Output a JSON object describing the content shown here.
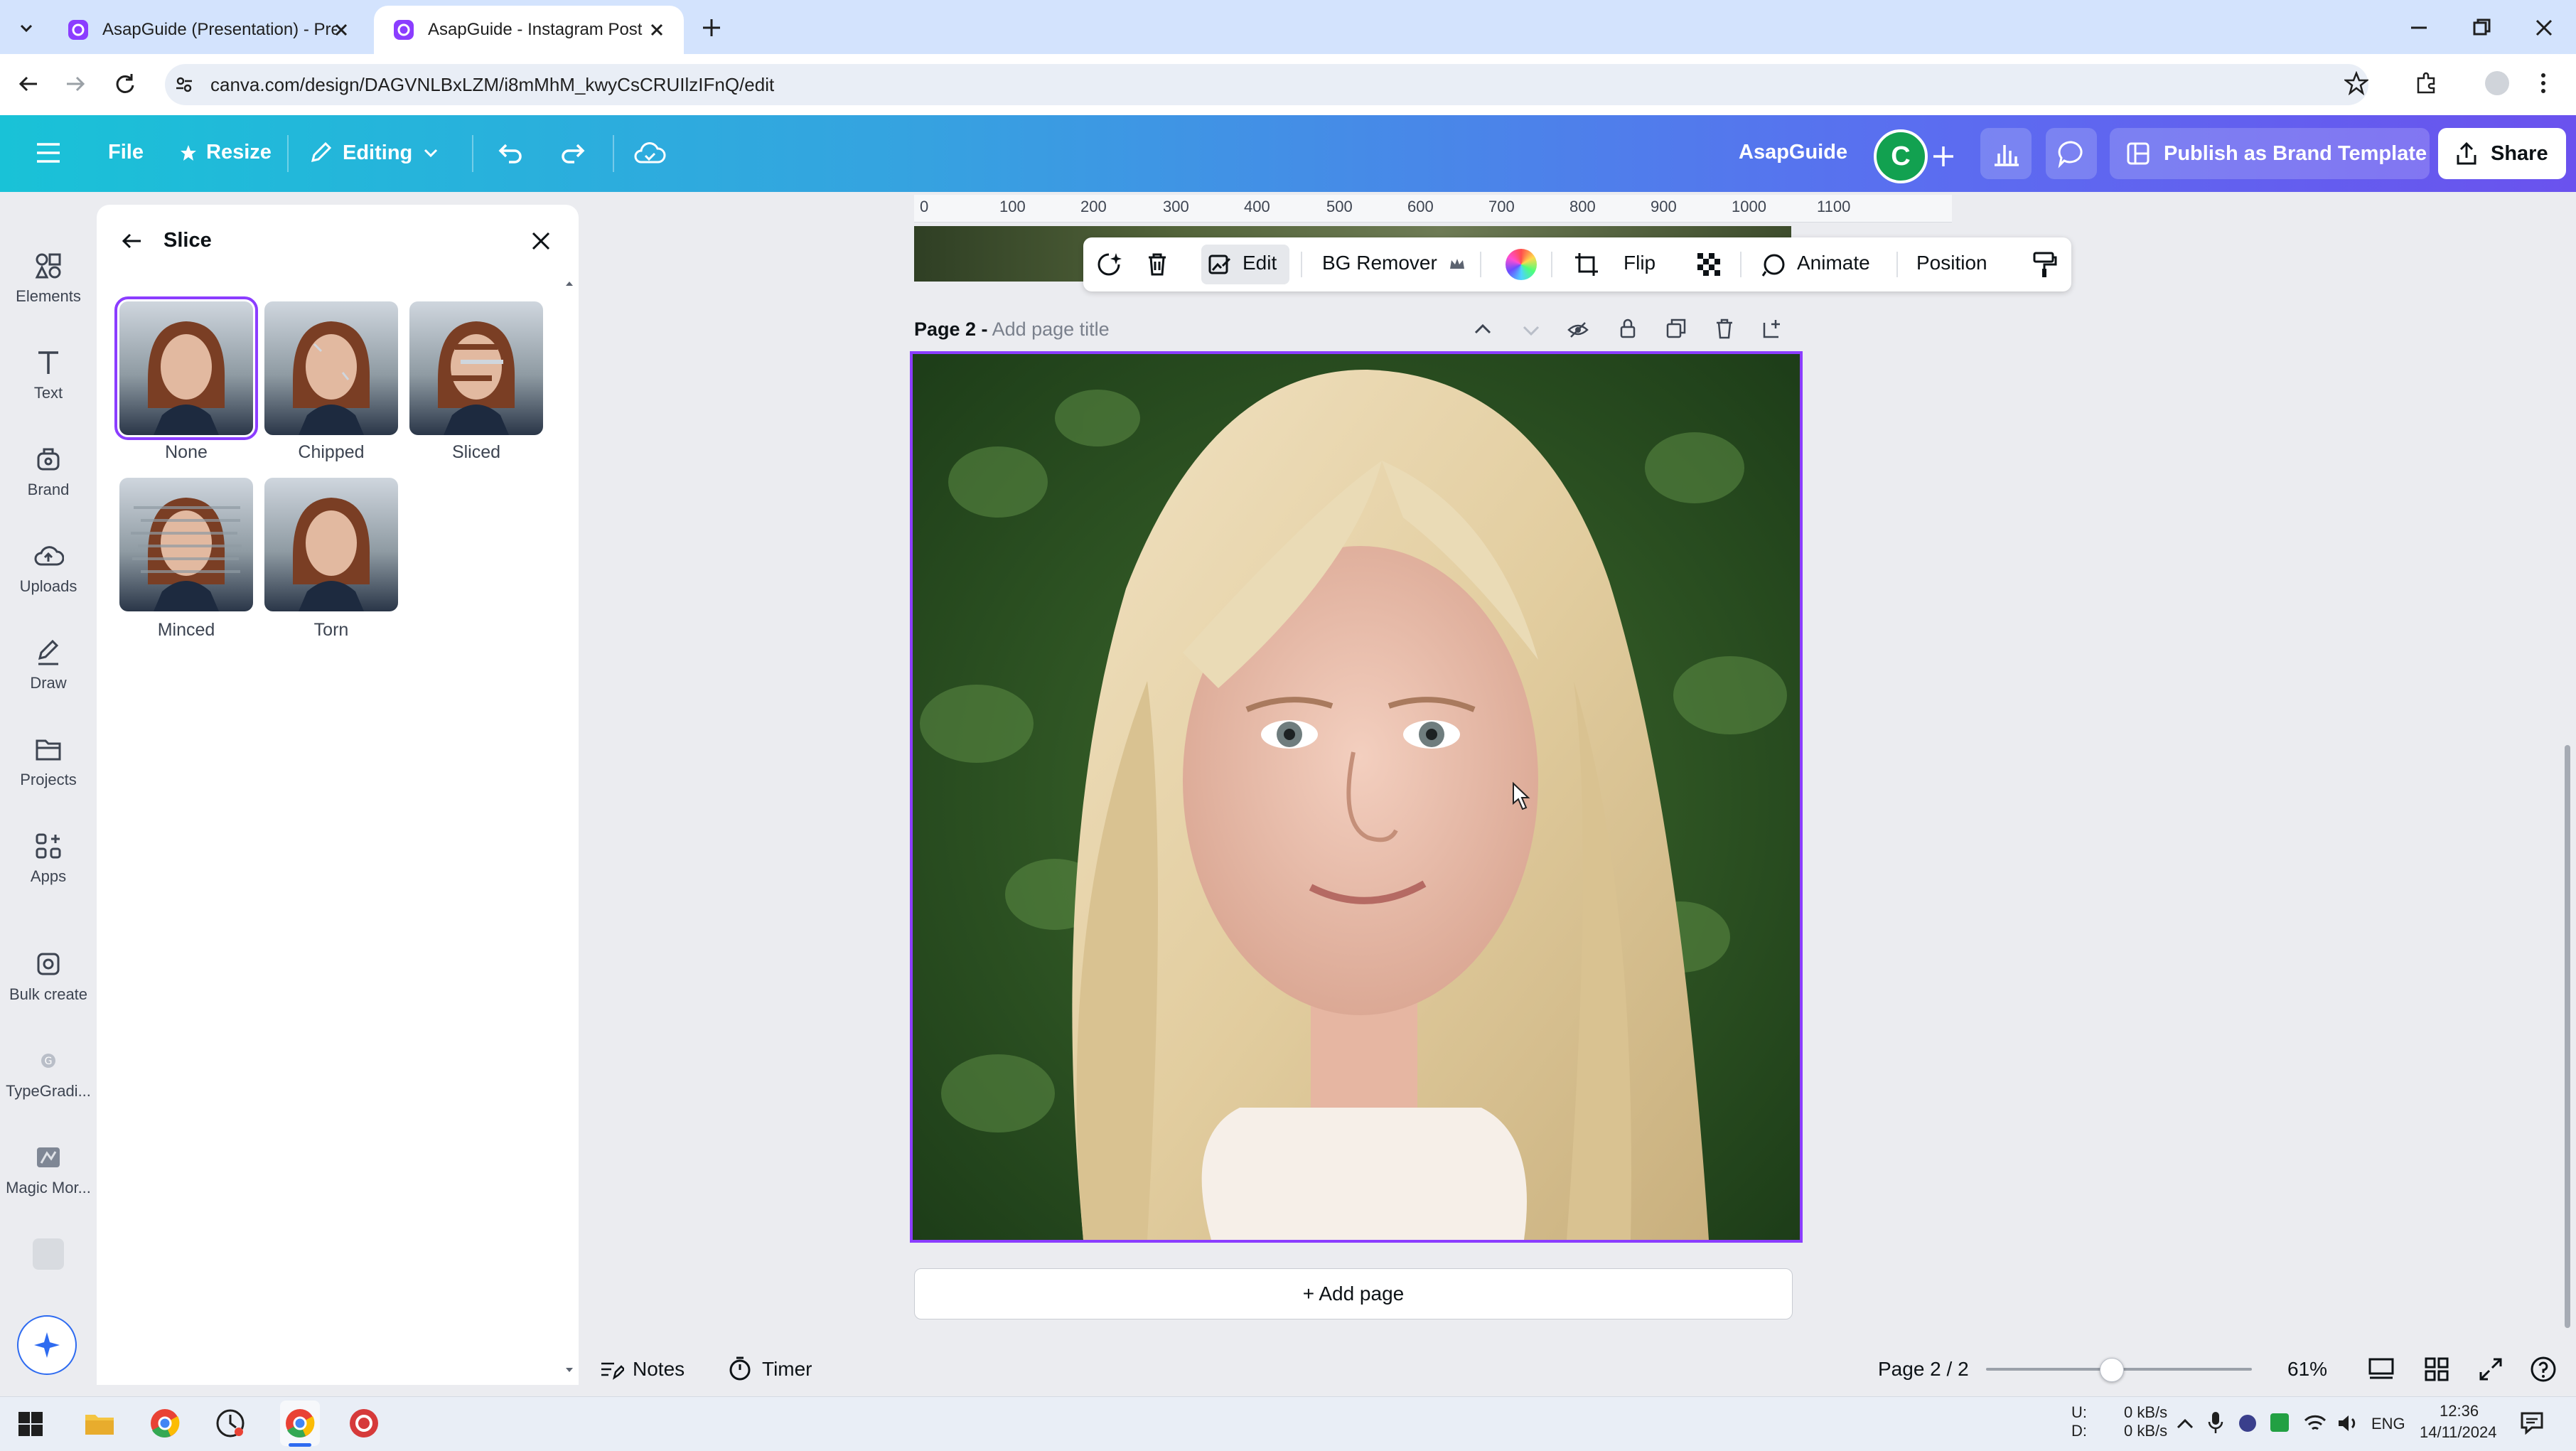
{
  "browser": {
    "tabs": [
      {
        "title": "AsapGuide (Presentation) - Pre",
        "active": false
      },
      {
        "title": "AsapGuide - Instagram Post",
        "active": true
      }
    ],
    "url": "canva.com/design/DAGVNLBxLZM/i8mMhM_kwyCsCRUIlzIFnQ/edit"
  },
  "header": {
    "file": "File",
    "resize": "Resize",
    "editing": "Editing",
    "team_name": "AsapGuide",
    "avatar_letter": "C",
    "publish": "Publish as Brand Template",
    "share": "Share",
    "accent_color": "#8b3dff",
    "avatar_color": "#12a150"
  },
  "rail": {
    "items": [
      {
        "label": "Elements",
        "icon": "elements-icon"
      },
      {
        "label": "Text",
        "icon": "text-icon"
      },
      {
        "label": "Brand",
        "icon": "brand-icon"
      },
      {
        "label": "Uploads",
        "icon": "uploads-icon"
      },
      {
        "label": "Draw",
        "icon": "draw-icon"
      },
      {
        "label": "Projects",
        "icon": "projects-icon"
      },
      {
        "label": "Apps",
        "icon": "apps-icon"
      },
      {
        "label": "Bulk create",
        "icon": "bulk-create-icon"
      },
      {
        "label": "TypeGradi...",
        "icon": "typegradient-icon"
      },
      {
        "label": "Magic Mor...",
        "icon": "magic-morph-icon"
      }
    ]
  },
  "panel": {
    "title": "Slice",
    "effects": [
      {
        "label": "None",
        "selected": true
      },
      {
        "label": "Chipped",
        "selected": false
      },
      {
        "label": "Sliced",
        "selected": false
      },
      {
        "label": "Minced",
        "selected": false
      },
      {
        "label": "Torn",
        "selected": false
      }
    ]
  },
  "ruler": {
    "ticks": [
      "0",
      "100",
      "200",
      "300",
      "400",
      "500",
      "600",
      "700",
      "800",
      "900",
      "1000",
      "1100"
    ]
  },
  "toolbar": {
    "edit": "Edit",
    "bg_remover": "BG Remover",
    "flip": "Flip",
    "animate": "Animate",
    "position": "Position"
  },
  "page": {
    "label": "Page 2 -",
    "title_placeholder": "Add page title",
    "add_page": "+ Add page"
  },
  "footer": {
    "notes": "Notes",
    "timer": "Timer",
    "page_count": "Page 2 / 2",
    "zoom": "61%",
    "zoom_fraction": 0.47
  },
  "taskbar": {
    "net_up_label": "U:",
    "net_down_label": "D:",
    "net_up": "0 kB/s",
    "net_down": "0 kB/s",
    "lang": "ENG",
    "time": "12:36",
    "date": "14/11/2024"
  }
}
